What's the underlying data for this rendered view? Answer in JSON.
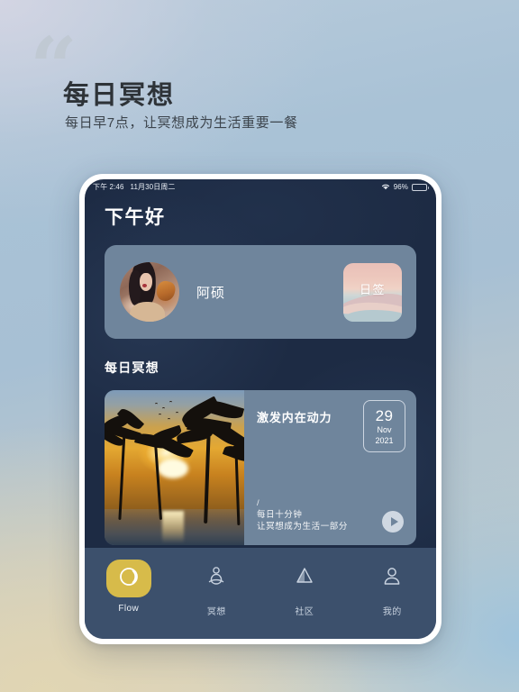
{
  "poster": {
    "quote_glyph": "“",
    "headline": "每日冥想",
    "subhead": "每日早7点，让冥想成为生活重要一餐"
  },
  "status_bar": {
    "time": "下午 2:46",
    "date": "11月30日周二",
    "wifi_icon": "wifi-icon",
    "battery_percent": "96%",
    "battery_icon": "battery-icon"
  },
  "app": {
    "greeting": "下午好",
    "profile": {
      "avatar_icon": "user-avatar-photo",
      "username": "阿硕",
      "daily_sign_label": "日签"
    },
    "section": {
      "title": "每日冥想"
    },
    "meditation_card": {
      "photo_icon": "sunset-palm-photo",
      "title": "激发内在动力",
      "date": {
        "day": "29",
        "month": "Nov",
        "year": "2021"
      },
      "sub_lines": [
        "/",
        "每日十分钟",
        "让冥想成为生活一部分"
      ],
      "play_icon": "play-icon"
    },
    "tabbar": {
      "items": [
        {
          "label": "Flow",
          "icon": "flow-circle-icon",
          "active": true
        },
        {
          "label": "冥想",
          "icon": "meditation-icon",
          "active": false
        },
        {
          "label": "社区",
          "icon": "community-gem-icon",
          "active": false
        },
        {
          "label": "我的",
          "icon": "profile-person-icon",
          "active": false
        }
      ]
    }
  },
  "colors": {
    "app_bg": "#1d2b44",
    "card_bg": "#6f859c",
    "tabbar_bg": "#3c506c",
    "accent_gold": "#d7bb4a",
    "text_primary": "#ffffff",
    "poster_text": "#2e3338"
  }
}
